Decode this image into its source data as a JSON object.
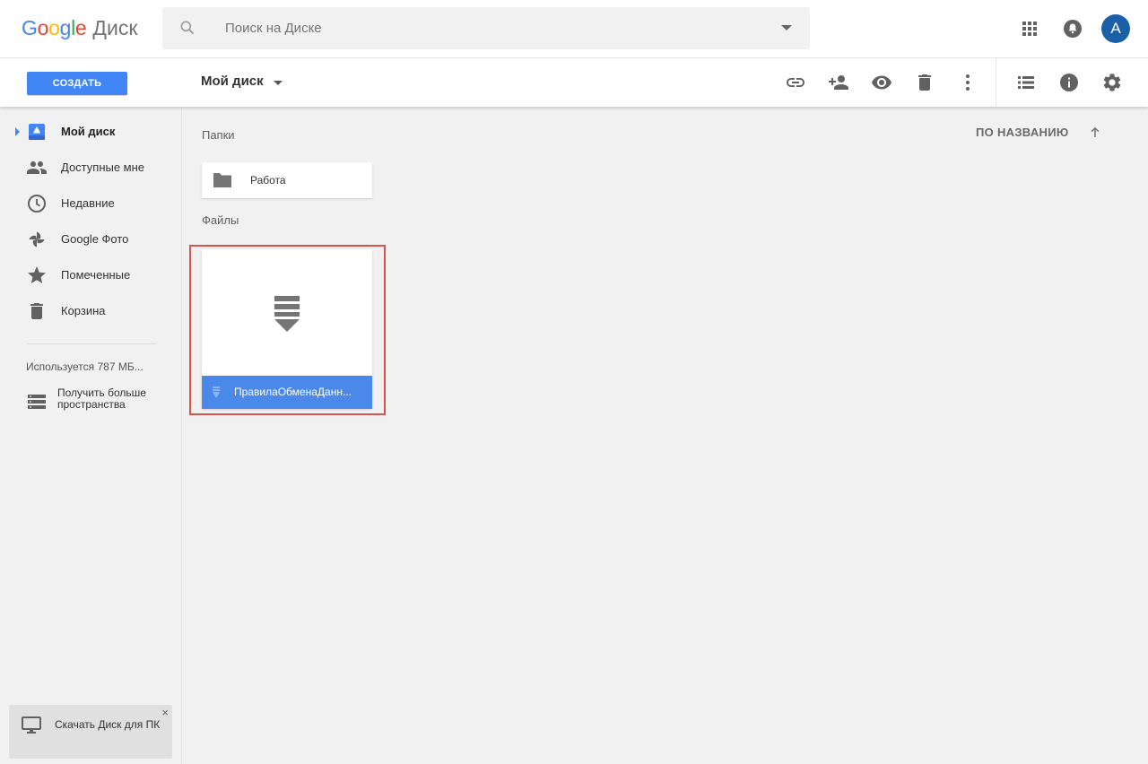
{
  "header": {
    "logo_word": "Google",
    "logo_product": "Диск",
    "search_placeholder": "Поиск на Диске",
    "avatar_letter": "A",
    "icons": [
      "apps-grid-icon",
      "notifications-bell-icon"
    ]
  },
  "toolbar": {
    "create_label": "СОЗДАТЬ",
    "location_title": "Мой диск",
    "icons": [
      "link-icon",
      "share-person-add-icon",
      "preview-eye-icon",
      "delete-trash-icon",
      "more-vertical-icon",
      "list-view-icon",
      "info-icon",
      "settings-gear-icon"
    ]
  },
  "sidebar": {
    "items": [
      {
        "label": "Мой диск",
        "icon": "my-drive-icon",
        "active": true
      },
      {
        "label": "Доступные мне",
        "icon": "shared-people-icon"
      },
      {
        "label": "Недавние",
        "icon": "clock-icon"
      },
      {
        "label": "Google Фото",
        "icon": "photos-pinwheel-icon"
      },
      {
        "label": "Помеченные",
        "icon": "star-icon"
      },
      {
        "label": "Корзина",
        "icon": "trash-icon"
      }
    ],
    "storage_text": "Используется 787 МБ...",
    "more_space_label": "Получить больше пространства",
    "download_label": "Скачать Диск для ПК",
    "download_close": "×"
  },
  "main": {
    "folders_heading": "Папки",
    "files_heading": "Файлы",
    "sort_label": "ПО НАЗВАНИЮ",
    "folders": [
      {
        "name": "Работа"
      }
    ],
    "files": [
      {
        "name": "ПравилаОбменаДанн..."
      }
    ]
  },
  "colors": {
    "accent": "#4285f4",
    "file_bar": "#4a89ea",
    "highlight_border": "#d9534f",
    "avatar": "#1a5fa8"
  }
}
